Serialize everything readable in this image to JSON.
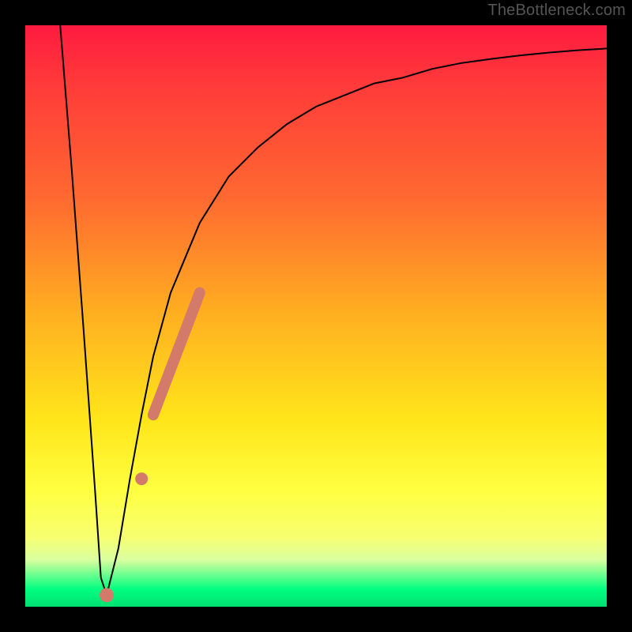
{
  "watermark": "TheBottleneck.com",
  "colors": {
    "frame": "#000000",
    "curve": "#000000",
    "marker": "#d47a6a",
    "gradient_top": "#ff1a40",
    "gradient_mid": "#ffe61a",
    "gradient_bottom": "#00e070"
  },
  "chart_data": {
    "type": "line",
    "title": "",
    "xlabel": "",
    "ylabel": "",
    "xlim": [
      0,
      100
    ],
    "ylim": [
      0,
      100
    ],
    "grid": false,
    "legend": false,
    "series": [
      {
        "name": "bottleneck-curve",
        "x": [
          6,
          8,
          10,
          12,
          13,
          14,
          16,
          18,
          20,
          22,
          25,
          30,
          35,
          40,
          45,
          50,
          55,
          60,
          65,
          70,
          75,
          80,
          85,
          90,
          95,
          100
        ],
        "y": [
          100,
          75,
          48,
          20,
          5,
          2,
          10,
          22,
          33,
          43,
          54,
          66,
          74,
          79,
          83,
          86,
          88,
          90,
          91,
          92.5,
          93.5,
          94.2,
          94.8,
          95.3,
          95.7,
          96
        ]
      }
    ],
    "markers": [
      {
        "name": "highlight-segment",
        "x_range": [
          22,
          30
        ],
        "y_range": [
          33,
          54
        ]
      },
      {
        "name": "highlight-dot-upper",
        "x": 20,
        "y": 22
      },
      {
        "name": "highlight-dot-lower",
        "x": 14,
        "y": 2
      }
    ],
    "notes": "Axes are unlabeled in the source image; values are normalized 0–100. y=0 corresponds to the green bottom band (best / no bottleneck), y=100 to the red top (worst)."
  }
}
